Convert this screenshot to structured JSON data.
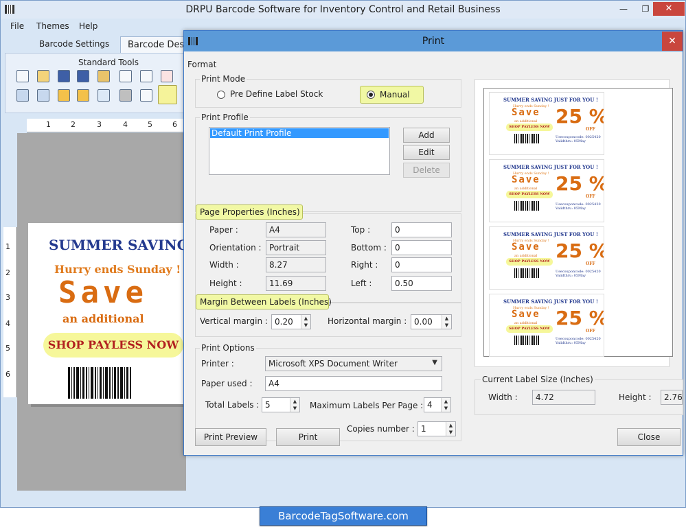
{
  "app": {
    "title": "DRPU Barcode Software for Inventory Control and Retail Business",
    "min_glyph": "—",
    "max_glyph": "❐",
    "close_glyph": "✕"
  },
  "menu": [
    "File",
    "Themes",
    "Help"
  ],
  "tabs": [
    "Barcode Settings",
    "Barcode Design"
  ],
  "toolbar": {
    "title": "Standard Tools"
  },
  "ruler": {
    "h": [
      "1",
      "2",
      "3",
      "4",
      "5",
      "6"
    ],
    "v": [
      "1",
      "2",
      "3",
      "4",
      "5",
      "6"
    ]
  },
  "label": {
    "title": "SUMMER SAVING",
    "hurry": "Hurry ends Sunday !",
    "save": "Save",
    "additional": "an additional",
    "shop": "SHOP PAYLESS NOW"
  },
  "dialog": {
    "title": "Print",
    "close_glyph": "✕",
    "format_label": "Format",
    "print_mode": {
      "legend": "Print Mode",
      "option_predefine": "Pre Define Label Stock",
      "option_manual": "Manual",
      "selected": "Manual"
    },
    "print_profile": {
      "legend": "Print Profile",
      "items": [
        "Default Print Profile"
      ],
      "add": "Add",
      "edit": "Edit",
      "delete": "Delete"
    },
    "page_properties": {
      "legend": "Page Properties (Inches)",
      "paper_label": "Paper :",
      "paper": "A4",
      "orientation_label": "Orientation :",
      "orientation": "Portrait",
      "width_label": "Width :",
      "width": "8.27",
      "height_label": "Height :",
      "height": "11.69",
      "top_label": "Top :",
      "top": "0",
      "bottom_label": "Bottom :",
      "bottom": "0",
      "right_label": "Right :",
      "right": "0",
      "left_label": "Left :",
      "left": "0.50"
    },
    "margin": {
      "legend": "Margin Between Labels (Inches)",
      "vertical_label": "Vertical margin :",
      "vertical": "0.20",
      "horizontal_label": "Horizontal margin :",
      "horizontal": "0.00"
    },
    "print_options": {
      "legend": "Print Options",
      "printer_label": "Printer :",
      "printer": "Microsoft XPS Document Writer",
      "paper_used_label": "Paper used :",
      "paper_used": "A4",
      "total_labels_label": "Total Labels :",
      "total_labels": "5",
      "max_per_page_label": "Maximum Labels Per Page :",
      "max_per_page": "4",
      "copies_label": "Copies number :",
      "copies": "1"
    },
    "preview": {
      "labels": [
        {
          "title": "SUMMER SAVING JUST FOR YOU !",
          "hurry": "Hurry ends Sunday !",
          "save": "Save",
          "additional": "an additional",
          "shop": "SHOP PAYLESS NOW",
          "percent": "25 %",
          "off": "OFF",
          "code": "Usecouponcode: 0025420",
          "valid": "Validthru: 05May"
        },
        {
          "title": "SUMMER SAVING JUST FOR YOU !",
          "hurry": "Hurry ends Sunday !",
          "save": "Save",
          "additional": "an additional",
          "shop": "SHOP PAYLESS NOW",
          "percent": "25 %",
          "off": "OFF",
          "code": "Usecouponcode: 0025420",
          "valid": "Validthru: 05May"
        },
        {
          "title": "SUMMER SAVING JUST FOR YOU !",
          "hurry": "Hurry ends Sunday !",
          "save": "Save",
          "additional": "an additional",
          "shop": "SHOP PAYLESS NOW",
          "percent": "25 %",
          "off": "OFF",
          "code": "Usecouponcode: 0025420",
          "valid": "Validthru: 05May"
        },
        {
          "title": "SUMMER SAVING JUST FOR YOU !",
          "hurry": "Hurry ends Sunday !",
          "save": "Save",
          "additional": "an additional",
          "shop": "SHOP PAYLESS NOW",
          "percent": "25 %",
          "off": "OFF",
          "code": "Usecouponcode: 0025420",
          "valid": "Validthru: 05May"
        }
      ]
    },
    "label_size": {
      "legend": "Current Label Size (Inches)",
      "width_label": "Width :",
      "width": "4.72",
      "height_label": "Height :",
      "height": "2.76"
    },
    "buttons": {
      "print_preview": "Print Preview",
      "print": "Print",
      "close": "Close"
    }
  },
  "watermark": "BarcodeTagSoftware.com",
  "colors": {
    "accent": "#5b9ad8",
    "highlight": "#f1f8a4",
    "label_title": "#243a8f",
    "label_orange": "#d96c12",
    "label_red": "#b22020",
    "close_red": "#c9463d"
  }
}
